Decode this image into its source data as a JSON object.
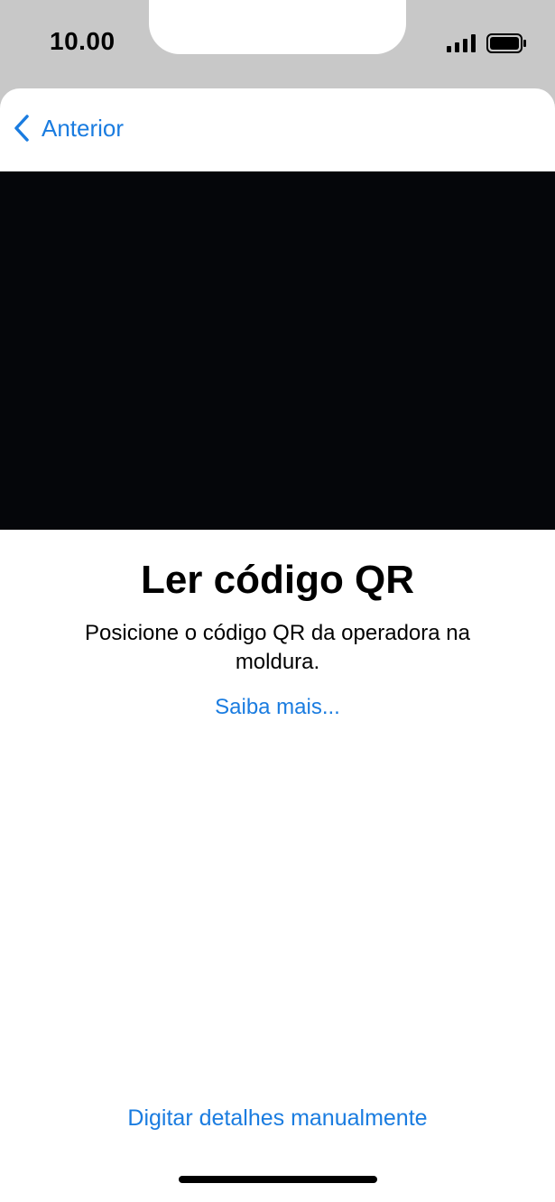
{
  "status_bar": {
    "time": "10.00",
    "signal_icon": "cellular-signal-icon",
    "battery_icon": "battery-icon"
  },
  "nav": {
    "back_icon": "chevron-left-icon",
    "back_label": "Anterior"
  },
  "scanner": {
    "title": "Ler código QR",
    "description": "Posicione o código QR da operadora na moldura.",
    "learn_more": "Saiba mais..."
  },
  "footer": {
    "manual_entry": "Digitar detalhes manualmente"
  },
  "colors": {
    "accent": "#1a7ce0",
    "camera_background": "#05060a",
    "status_area": "#c8c8c8"
  }
}
